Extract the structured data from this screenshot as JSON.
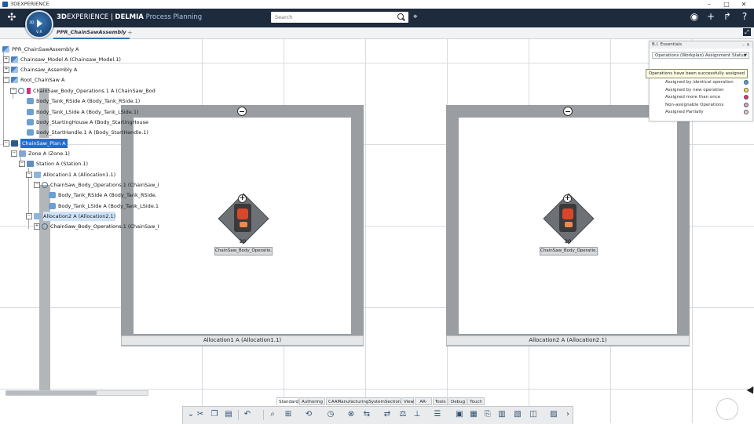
{
  "titlebar": {
    "title": "3DEXPERIENCE",
    "minimize": "–",
    "maximize": "□",
    "close": "✕"
  },
  "topbar": {
    "brand_prefix": "3D",
    "brand_main": "EXPERIENCE",
    "brand_sep": " | ",
    "brand_product": "DELMIA",
    "brand_app": " Process Planning",
    "compass_top": "3D",
    "compass_bottom": "V,R",
    "search_placeholder": "Search"
  },
  "tab": {
    "label": "PPR_ChainSawAssembly"
  },
  "tree": {
    "items": [
      {
        "label": "PPR_ChainSawAssembly A"
      },
      {
        "label": "Chainsaw_Model A (Chainsaw_Model.1)"
      },
      {
        "label": "Chainsaw_Assembly A"
      },
      {
        "label": "Root_ChainSaw A"
      },
      {
        "label": "ChainSaw_Body_Operations.1 A (ChainSaw_Bod"
      },
      {
        "label": "Body_Tank_RSide A (Body_Tank_RSide.1)"
      },
      {
        "label": "Body_Tank_LSide A (Body_Tank_LSide.1)"
      },
      {
        "label": "Body_StartingHouse A (Body_StartingHouse"
      },
      {
        "label": "Body_StartHandle.1 A (Body_StartHandle.1)"
      },
      {
        "label": "ChainSaw_Plan A"
      },
      {
        "label": "Zone A (Zone.1)"
      },
      {
        "label": "Station A (Station.1)"
      },
      {
        "label": "Allocation1 A (Allocation1.1)"
      },
      {
        "label": "ChainSaw_Body_Operations.1 (ChainSaw_I"
      },
      {
        "label": "Body_Tank_RSide A (Body_Tank_RSide."
      },
      {
        "label": "Body_Tank_LSide A (Body_Tank_LSide.1"
      },
      {
        "label": "Allocation2 A (Allocation2.1)"
      },
      {
        "label": "ChainSaw_Body_Operations.1 (ChainSaw_I"
      }
    ]
  },
  "panels": [
    {
      "caption": "Allocation1 A (Allocation1.1)",
      "node_label": "ChainSaw_Body_Operatio...",
      "count": "20"
    },
    {
      "caption": "Allocation2 A (Allocation2.1)",
      "node_label": "ChainSaw_Body_Operatio...",
      "count": "20"
    }
  ],
  "bi": {
    "title": "B.I. Essentials",
    "select_value": "Operations (Workplan) Assignment Status",
    "tooltip": "Operations have been successfully assigned",
    "legend": [
      {
        "label": "Assigned by identical operation",
        "color": "#3ea8e0"
      },
      {
        "label": "Assigned by new operation",
        "color": "#f2e14a"
      },
      {
        "label": "Assigned more than once",
        "color": "#d9307a"
      },
      {
        "label": "Non-assignable Operations",
        "color": "#c9a9d9"
      },
      {
        "label": "Assigned Partially",
        "color": "#f4c6cf"
      }
    ]
  },
  "toolbar_tabs": [
    "Standard",
    "Authoring",
    "CAAManufacturingSystemSection",
    "View",
    "AR-VR",
    "Tools",
    "Debug",
    "Touch"
  ],
  "icons": {
    "ds_logo": "ds-logo-icon",
    "tag": "tag-icon",
    "user": "user-icon",
    "add": "plus-icon",
    "share": "share-icon",
    "help": "help-icon",
    "expand": "expand-icon"
  }
}
